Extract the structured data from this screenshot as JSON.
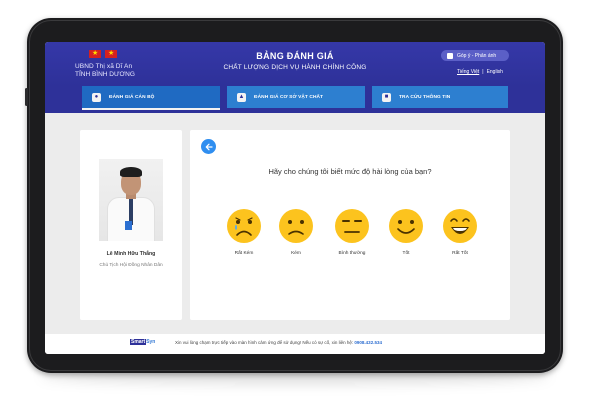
{
  "header": {
    "org_line1": "UBND Thị xã Dĩ An",
    "org_line2": "TỈNH BÌNH DƯƠNG",
    "title": "BẢNG ĐÁNH GIÁ",
    "subtitle": "CHẤT LƯỢNG DỊCH VỤ HÀNH CHÍNH CÔNG",
    "feedback_label": "Góp ý - Phản ánh",
    "languages": [
      "Tiếng Việt",
      "English"
    ],
    "language_separator": "|",
    "flag_icon": "vietnam-flag-icon",
    "flag_star": "★"
  },
  "nav": {
    "tabs": [
      {
        "label": "ĐÁNH GIÁ CÁN BỘ",
        "icon": "officer-icon",
        "active": true
      },
      {
        "label": "ĐÁNH GIÁ CƠ SỞ VẬT CHẤT",
        "icon": "thumbs-up-icon",
        "active": false
      },
      {
        "label": "TRA CỨU THÔNG TIN",
        "icon": "document-search-icon",
        "active": false
      }
    ]
  },
  "officer": {
    "name": "Lê Minh Hữu Thắng",
    "role": "Chủ Tịch Hội Đồng Nhân Dân"
  },
  "rating": {
    "question": "Hãy cho chúng tôi biết mức độ hài lòng của bạn?",
    "back_icon": "arrow-left-icon",
    "options": [
      {
        "label": "Rất Kém",
        "icon": "very-sad-face-icon"
      },
      {
        "label": "Kém",
        "icon": "sad-face-icon"
      },
      {
        "label": "Bình thường",
        "icon": "neutral-face-icon"
      },
      {
        "label": "Tốt",
        "icon": "smile-face-icon"
      },
      {
        "label": "Rất Tốt",
        "icon": "laughing-face-icon"
      }
    ]
  },
  "footer": {
    "brand_part1": "Smart",
    "brand_part2": "Syn",
    "note": "Xin vui lòng chạm trực tiếp vào màn hình cảm ứng để sử dụng! Nếu có sự cố, xin liên hệ:",
    "phone": "0908.432.534"
  },
  "colors": {
    "header": "#2e3199",
    "tab": "#2d7fd0",
    "emoji": "#fcc31e",
    "accent": "#2f8ef0"
  }
}
